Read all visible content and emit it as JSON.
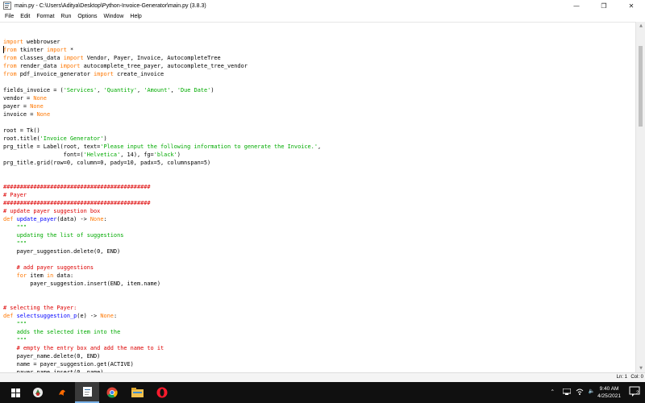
{
  "window": {
    "title": "main.py - C:\\Users\\Aditya\\Desktop\\Python-Invoice-Generator\\main.py (3.8.3)"
  },
  "menu": [
    "File",
    "Edit",
    "Format",
    "Run",
    "Options",
    "Window",
    "Help"
  ],
  "window_controls": {
    "minimize": "—",
    "maximize": "❐",
    "close": "✕"
  },
  "code_lines": [
    [
      {
        "t": ""
      }
    ],
    [
      {
        "t": "import",
        "c": "kw"
      },
      {
        "t": " webbrowser"
      }
    ],
    [
      {
        "t": "from",
        "c": "kw"
      },
      {
        "t": " tkinter "
      },
      {
        "t": "import",
        "c": "kw"
      },
      {
        "t": " *"
      }
    ],
    [
      {
        "t": "from",
        "c": "kw"
      },
      {
        "t": " classes_data "
      },
      {
        "t": "import",
        "c": "kw"
      },
      {
        "t": " Vendor, Payer, Invoice, AutocompleteTree"
      }
    ],
    [
      {
        "t": "from",
        "c": "kw"
      },
      {
        "t": " render_data "
      },
      {
        "t": "import",
        "c": "kw"
      },
      {
        "t": " autocomplete_tree_payer, autocomplete_tree_vendor"
      }
    ],
    [
      {
        "t": "from",
        "c": "kw"
      },
      {
        "t": " pdf_invoice_generator "
      },
      {
        "t": "import",
        "c": "kw"
      },
      {
        "t": " create_invoice"
      }
    ],
    [
      {
        "t": ""
      }
    ],
    [
      {
        "t": "fields_invoice = ("
      },
      {
        "t": "'Services'",
        "c": "str"
      },
      {
        "t": ", "
      },
      {
        "t": "'Quantity'",
        "c": "str"
      },
      {
        "t": ", "
      },
      {
        "t": "'Amount'",
        "c": "str"
      },
      {
        "t": ", "
      },
      {
        "t": "'Due Date'",
        "c": "str"
      },
      {
        "t": ")"
      }
    ],
    [
      {
        "t": "vendor = "
      },
      {
        "t": "None",
        "c": "kw"
      }
    ],
    [
      {
        "t": "payer = "
      },
      {
        "t": "None",
        "c": "kw"
      }
    ],
    [
      {
        "t": "invoice = "
      },
      {
        "t": "None",
        "c": "kw"
      }
    ],
    [
      {
        "t": ""
      }
    ],
    [
      {
        "t": "root = Tk()"
      }
    ],
    [
      {
        "t": "root.title("
      },
      {
        "t": "'Invoice Generator'",
        "c": "str"
      },
      {
        "t": ")"
      }
    ],
    [
      {
        "t": "prg_title = Label(root, text="
      },
      {
        "t": "'Please input the following information to generate the Invoice.'",
        "c": "str"
      },
      {
        "t": ","
      }
    ],
    [
      {
        "t": "                  font=("
      },
      {
        "t": "'Helvetica'",
        "c": "str"
      },
      {
        "t": ", 14), fg="
      },
      {
        "t": "'black'",
        "c": "str"
      },
      {
        "t": ")"
      }
    ],
    [
      {
        "t": "prg_title.grid(row=0, column=0, pady=10, padx=5, columnspan=5)"
      }
    ],
    [
      {
        "t": ""
      }
    ],
    [
      {
        "t": ""
      }
    ],
    [
      {
        "t": "############################################",
        "c": "cmt"
      }
    ],
    [
      {
        "t": "# Payer",
        "c": "cmt"
      }
    ],
    [
      {
        "t": "############################################",
        "c": "cmt"
      }
    ],
    [
      {
        "t": "# update payer suggestion box",
        "c": "cmt"
      }
    ],
    [
      {
        "t": "def",
        "c": "kw"
      },
      {
        "t": " "
      },
      {
        "t": "update_payer",
        "c": "def"
      },
      {
        "t": "(data) -> "
      },
      {
        "t": "None",
        "c": "kw"
      },
      {
        "t": ":"
      }
    ],
    [
      {
        "t": "    "
      },
      {
        "t": "\"\"\"",
        "c": "str"
      }
    ],
    [
      {
        "t": "    "
      },
      {
        "t": "updating the list of suggestions",
        "c": "str"
      }
    ],
    [
      {
        "t": "    "
      },
      {
        "t": "\"\"\"",
        "c": "str"
      }
    ],
    [
      {
        "t": "    payer_suggestion.delete(0, END)"
      }
    ],
    [
      {
        "t": ""
      }
    ],
    [
      {
        "t": "    "
      },
      {
        "t": "# add payer suggestions",
        "c": "cmt"
      }
    ],
    [
      {
        "t": "    "
      },
      {
        "t": "for",
        "c": "kw"
      },
      {
        "t": " item "
      },
      {
        "t": "in",
        "c": "kw"
      },
      {
        "t": " data:"
      }
    ],
    [
      {
        "t": "        payer_suggestion.insert(END, item.name)"
      }
    ],
    [
      {
        "t": ""
      }
    ],
    [
      {
        "t": ""
      }
    ],
    [
      {
        "t": "# selecting the Payer:",
        "c": "cmt"
      }
    ],
    [
      {
        "t": "def",
        "c": "kw"
      },
      {
        "t": " "
      },
      {
        "t": "selectsuggestion_p",
        "c": "def"
      },
      {
        "t": "(e) -> "
      },
      {
        "t": "None",
        "c": "kw"
      },
      {
        "t": ":"
      }
    ],
    [
      {
        "t": "    "
      },
      {
        "t": "\"\"\"",
        "c": "str"
      }
    ],
    [
      {
        "t": "    "
      },
      {
        "t": "adds the selected item into the",
        "c": "str"
      }
    ],
    [
      {
        "t": "    "
      },
      {
        "t": "\"\"\"",
        "c": "str"
      }
    ],
    [
      {
        "t": "    "
      },
      {
        "t": "# empty the entry box and add the name to it",
        "c": "cmt"
      }
    ],
    [
      {
        "t": "    payer_name.delete(0, END)"
      }
    ],
    [
      {
        "t": "    name = payer_suggestion.get(ACTIVE)"
      }
    ],
    [
      {
        "t": "    payer_name.insert(0, name)"
      }
    ]
  ],
  "status": {
    "line": "Ln: 1",
    "col": "Col: 0"
  },
  "clock": {
    "time": "9:40 AM",
    "date": "4/25/2021"
  },
  "notifications": "2",
  "taskbar_apps": [
    "windows-start",
    "search",
    "idle",
    "chrome",
    "file-explorer",
    "opera"
  ]
}
